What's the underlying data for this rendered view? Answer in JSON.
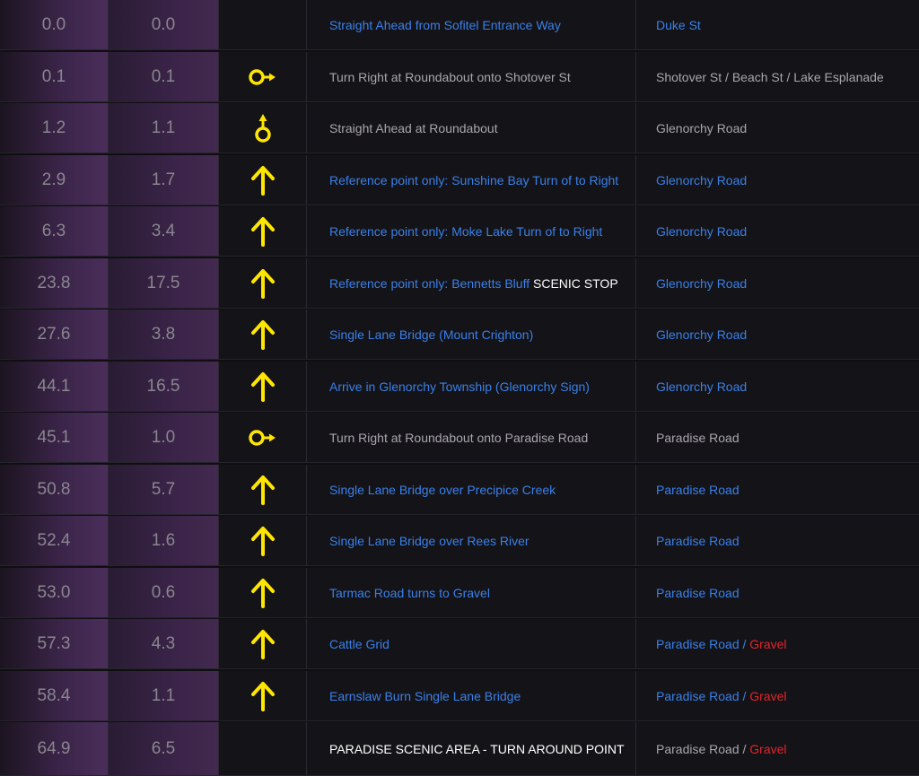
{
  "rows": [
    {
      "km": "0.0",
      "inc": "0.0",
      "icon": "none",
      "desc": [
        {
          "t": "Straight Ahead from Sofitel Entrance Way",
          "c": "blue"
        }
      ],
      "road": [
        {
          "t": "Duke St",
          "c": "blue"
        }
      ]
    },
    {
      "km": "0.1",
      "inc": "0.1",
      "icon": "roundabout-right",
      "desc": [
        {
          "t": "Turn Right at Roundabout onto Shotover St",
          "c": "grey"
        }
      ],
      "road": [
        {
          "t": "Shotover St / Beach St / Lake Esplanade",
          "c": "grey"
        }
      ]
    },
    {
      "km": "1.2",
      "inc": "1.1",
      "icon": "roundabout-straight",
      "desc": [
        {
          "t": "Straight Ahead at Roundabout",
          "c": "grey"
        }
      ],
      "road": [
        {
          "t": "Glenorchy Road",
          "c": "grey"
        }
      ]
    },
    {
      "km": "2.9",
      "inc": "1.7",
      "icon": "arrow-up",
      "desc": [
        {
          "t": "Reference point only: Sunshine Bay Turn of to Right",
          "c": "blue"
        }
      ],
      "road": [
        {
          "t": "Glenorchy Road",
          "c": "blue"
        }
      ]
    },
    {
      "km": "6.3",
      "inc": "3.4",
      "icon": "arrow-up",
      "desc": [
        {
          "t": "Reference point only: Moke Lake Turn of to Right",
          "c": "blue"
        }
      ],
      "road": [
        {
          "t": "Glenorchy Road",
          "c": "blue"
        }
      ]
    },
    {
      "km": "23.8",
      "inc": "17.5",
      "icon": "arrow-up",
      "desc": [
        {
          "t": "Reference point only: Bennetts Bluff ",
          "c": "blue"
        },
        {
          "t": "SCENIC STOP",
          "c": "white"
        }
      ],
      "road": [
        {
          "t": "Glenorchy Road",
          "c": "blue"
        }
      ]
    },
    {
      "km": "27.6",
      "inc": "3.8",
      "icon": "arrow-up",
      "desc": [
        {
          "t": "Single Lane Bridge (Mount Crighton)",
          "c": "blue"
        }
      ],
      "road": [
        {
          "t": "Glenorchy Road",
          "c": "blue"
        }
      ]
    },
    {
      "km": "44.1",
      "inc": "16.5",
      "icon": "arrow-up",
      "desc": [
        {
          "t": "Arrive in Glenorchy Township (Glenorchy Sign)",
          "c": "blue"
        }
      ],
      "road": [
        {
          "t": "Glenorchy Road",
          "c": "blue"
        }
      ]
    },
    {
      "km": "45.1",
      "inc": "1.0",
      "icon": "roundabout-right",
      "desc": [
        {
          "t": "Turn Right at Roundabout onto Paradise Road",
          "c": "grey"
        }
      ],
      "road": [
        {
          "t": "Paradise Road",
          "c": "grey"
        }
      ]
    },
    {
      "km": "50.8",
      "inc": "5.7",
      "icon": "arrow-up",
      "desc": [
        {
          "t": "Single Lane Bridge over Precipice Creek",
          "c": "blue"
        }
      ],
      "road": [
        {
          "t": "Paradise Road",
          "c": "blue"
        }
      ]
    },
    {
      "km": "52.4",
      "inc": "1.6",
      "icon": "arrow-up",
      "desc": [
        {
          "t": "Single Lane Bridge over Rees River",
          "c": "blue"
        }
      ],
      "road": [
        {
          "t": "Paradise Road",
          "c": "blue"
        }
      ]
    },
    {
      "km": "53.0",
      "inc": "0.6",
      "icon": "arrow-up",
      "desc": [
        {
          "t": "Tarmac Road turns to Gravel",
          "c": "blue"
        }
      ],
      "road": [
        {
          "t": "Paradise Road",
          "c": "blue"
        }
      ]
    },
    {
      "km": "57.3",
      "inc": "4.3",
      "icon": "arrow-up",
      "desc": [
        {
          "t": "Cattle Grid",
          "c": "blue"
        }
      ],
      "road": [
        {
          "t": "Paradise Road / ",
          "c": "blue"
        },
        {
          "t": "Gravel",
          "c": "red"
        }
      ]
    },
    {
      "km": "58.4",
      "inc": "1.1",
      "icon": "arrow-up",
      "desc": [
        {
          "t": "Earnslaw Burn Single Lane Bridge",
          "c": "blue"
        }
      ],
      "road": [
        {
          "t": "Paradise Road / ",
          "c": "blue"
        },
        {
          "t": "Gravel",
          "c": "red"
        }
      ]
    },
    {
      "km": "64.9",
      "inc": "6.5",
      "icon": "none",
      "desc": [
        {
          "t": "PARADISE SCENIC AREA - TURN AROUND POINT",
          "c": "white"
        }
      ],
      "road": [
        {
          "t": "Paradise Road / ",
          "c": "grey"
        },
        {
          "t": "Gravel",
          "c": "red"
        }
      ]
    }
  ]
}
